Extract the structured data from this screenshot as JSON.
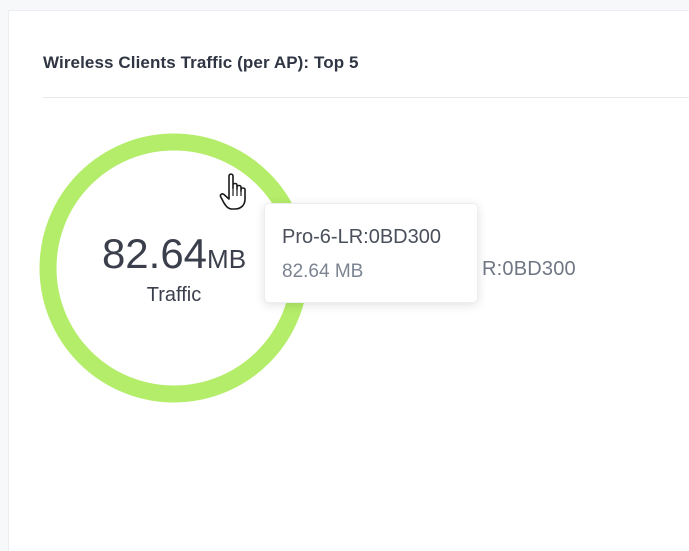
{
  "card": {
    "title": "Wireless Clients Traffic (per AP): Top 5"
  },
  "donut": {
    "center_value": "82.64",
    "center_unit": "MB",
    "center_label": "Traffic",
    "ring_color": "#b4ed6a"
  },
  "legend": {
    "visible_text": "R:0BD300"
  },
  "tooltip": {
    "name": "Pro-6-LR:0BD300",
    "value": "82.64 MB"
  },
  "chart_data": {
    "type": "pie",
    "series": [
      {
        "name": "Pro-6-LR:0BD300",
        "value": 82.64,
        "unit": "MB",
        "color": "#b4ed6a"
      }
    ]
  },
  "cursor": {
    "icon": "hand-pointer-icon"
  }
}
